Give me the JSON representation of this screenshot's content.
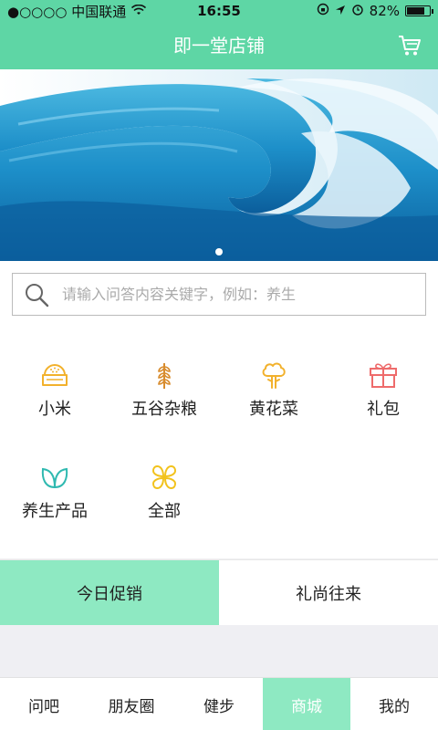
{
  "status": {
    "carrier": "●○○○○ 中国联通",
    "time": "16:55",
    "battery_text": "82%",
    "battery_level": 0.82
  },
  "nav": {
    "title": "即一堂店铺",
    "cart_icon": "cart-icon"
  },
  "banner": {
    "image": "ocean-wave",
    "dots": 1
  },
  "search": {
    "placeholder": "请输入问答内容关键字，例如：养生"
  },
  "categories": [
    {
      "label": "小米",
      "icon": "rice-bowl-icon",
      "color": "#f2b12c"
    },
    {
      "label": "五谷杂粮",
      "icon": "wheat-icon",
      "color": "#d88c2e"
    },
    {
      "label": "黄花菜",
      "icon": "flower-icon",
      "color": "#f2b12c"
    },
    {
      "label": "礼包",
      "icon": "gift-icon",
      "color": "#ee6b6b"
    },
    {
      "label": "养生产品",
      "icon": "leaf-icon",
      "color": "#2fb9b0"
    },
    {
      "label": "全部",
      "icon": "clover-icon",
      "color": "#f2c21c"
    }
  ],
  "tabs": [
    {
      "label": "今日促销",
      "active": true
    },
    {
      "label": "礼尚往来",
      "active": false
    }
  ],
  "bottom_nav": [
    {
      "label": "问吧",
      "active": false
    },
    {
      "label": "朋友圈",
      "active": false
    },
    {
      "label": "健步",
      "active": false
    },
    {
      "label": "商城",
      "active": true
    },
    {
      "label": "我的",
      "active": false
    }
  ],
  "colors": {
    "accent": "#5ed6a5",
    "active_tab": "#8ee9c2"
  }
}
